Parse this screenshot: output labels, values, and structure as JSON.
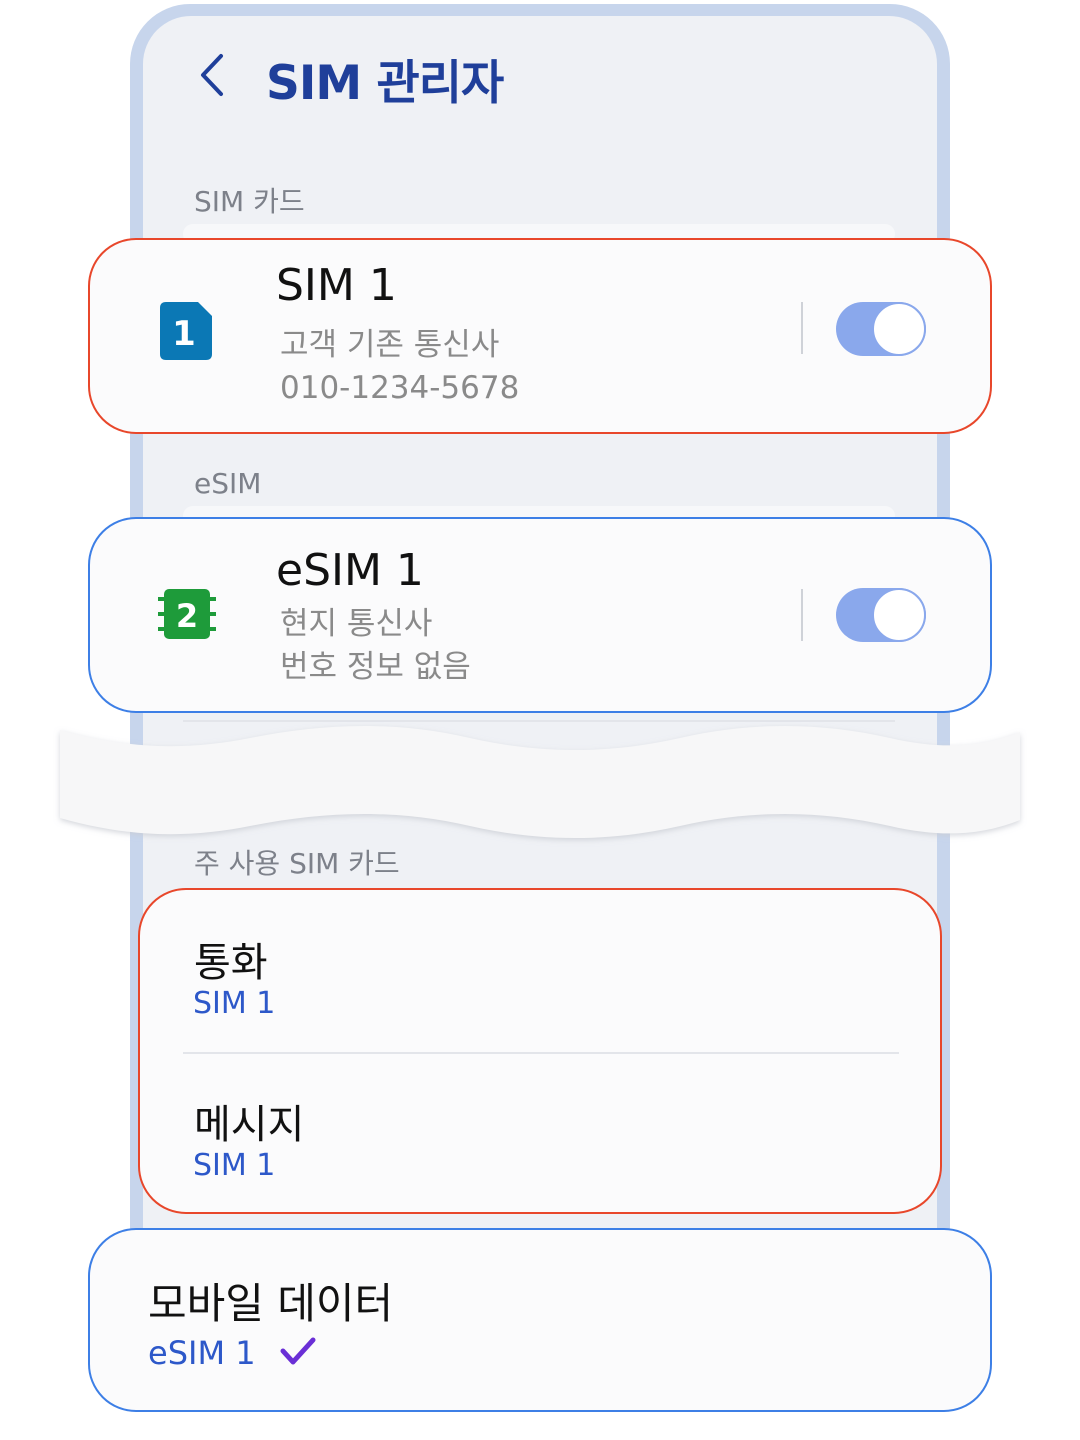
{
  "header": {
    "title": "SIM 관리자",
    "back_icon": "chevron-left-icon"
  },
  "sections": {
    "sim_cards": "SIM 카드",
    "esim": "eSIM",
    "preferred": "주 사용 SIM 카드"
  },
  "sim1": {
    "name": "SIM 1",
    "carrier": "고객 기존 통신사",
    "number": "010-1234-5678",
    "badge": "1",
    "badge_color": "#0b78b5",
    "enabled": true
  },
  "esim1": {
    "name": "eSIM 1",
    "carrier": "현지 통신사",
    "number": "번호 정보 없음",
    "badge": "2",
    "badge_color": "#1e9b3a",
    "enabled": true
  },
  "preferences": {
    "calls": {
      "label": "통화",
      "value": "SIM 1"
    },
    "messages": {
      "label": "메시지",
      "value": "SIM 1"
    },
    "mobile_data": {
      "label": "모바일 데이터",
      "value": "eSIM 1",
      "check_icon": "checkmark-icon"
    }
  },
  "colors": {
    "accent_blue": "#2d58c9",
    "highlight_red": "#e8472b",
    "highlight_blue": "#3d7fe6",
    "toggle_on": "#8aa8ec",
    "check": "#6a2fd6"
  }
}
